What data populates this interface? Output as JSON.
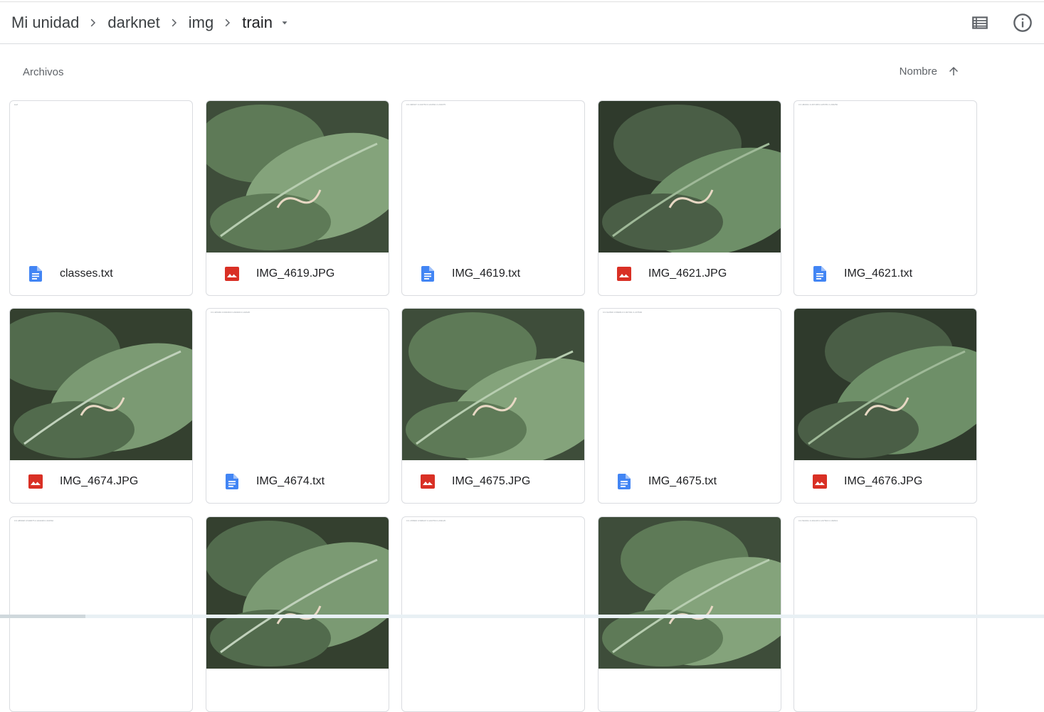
{
  "breadcrumb": [
    "Mi unidad",
    "darknet",
    "img",
    "train"
  ],
  "section_label": "Archivos",
  "sort": {
    "label": "Nombre",
    "direction": "ascending"
  },
  "header_icons": [
    "list-view-icon",
    "info-icon"
  ],
  "colors": {
    "doc_blue": "#4285f4",
    "image_red": "#d93025",
    "border": "#dadce0"
  },
  "files": [
    {
      "name": "classes.txt",
      "type": "doc",
      "preview": "leaf"
    },
    {
      "name": "IMG_4619.JPG",
      "type": "image"
    },
    {
      "name": "IMG_4619.txt",
      "type": "doc",
      "preview": "0 0.498437 0.443750 0.244531 0.234375"
    },
    {
      "name": "IMG_4621.JPG",
      "type": "image"
    },
    {
      "name": "IMG_4621.txt",
      "type": "doc",
      "preview": "0 0.482031 0.467188 0.225781 0.206250"
    },
    {
      "name": "IMG_4674.JPG",
      "type": "image"
    },
    {
      "name": "IMG_4674.txt",
      "type": "doc",
      "preview": "0 0.405469 0.630469 0.230469 0.140625"
    },
    {
      "name": "IMG_4675.JPG",
      "type": "image"
    },
    {
      "name": "IMG_4675.txt",
      "type": "doc",
      "preview": "0 0.612500 0.582813 0.307031 0.237500"
    },
    {
      "name": "IMG_4676.JPG",
      "type": "image"
    },
    {
      "name": "",
      "type": "doc",
      "preview": "0 0.485938 0.546875 0.323438 0.301562"
    },
    {
      "name": "",
      "type": "image"
    },
    {
      "name": "",
      "type": "doc",
      "preview": "0 0.478906 0.598437 0.243750 0.203125"
    },
    {
      "name": "",
      "type": "image"
    },
    {
      "name": "",
      "type": "doc",
      "preview": "0 0.532031 0.491406 0.237500 0.182813"
    }
  ]
}
